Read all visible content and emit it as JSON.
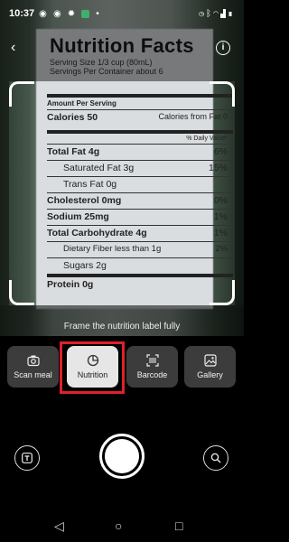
{
  "status_bar": {
    "time": "10:37",
    "left_icons": [
      "whatsapp-icon",
      "whatsapp-icon",
      "settings-icon",
      "app-icon",
      "dot-icon"
    ],
    "right_icons": [
      "alarm-icon",
      "bluetooth-icon",
      "wifi-icon",
      "signal-icon",
      "battery-icon"
    ]
  },
  "label_preview": {
    "title": "Nutrition Facts",
    "serving_size": "Serving Size 1/3 cup (80mL)",
    "servings_per": "Servings Per Container about 6",
    "amount_per": "Amount Per Serving",
    "calories": "Calories 50",
    "calories_fat": "Calories from Fat 0",
    "daily_value": "% Daily Value*",
    "rows": [
      {
        "label": "Total Fat 4g",
        "value": "6%"
      },
      {
        "label": "Saturated Fat 3g",
        "value": "15%"
      },
      {
        "label": "Trans Fat 0g",
        "value": ""
      },
      {
        "label": "Cholesterol 0mg",
        "value": "0%"
      },
      {
        "label": "Sodium 25mg",
        "value": "1%"
      },
      {
        "label": "Total Carbohydrate 4g",
        "value": "1%"
      },
      {
        "label": "Dietary Fiber less than 1g",
        "value": "2%"
      },
      {
        "label": "Sugars 2g",
        "value": ""
      },
      {
        "label": "Protein 0g",
        "value": ""
      }
    ]
  },
  "hint_text": "Frame the nutrition label fully",
  "modes": [
    {
      "label": "Scan meal",
      "icon": "camera-icon",
      "active": false
    },
    {
      "label": "Nutrition",
      "icon": "pie-chart-icon",
      "active": true
    },
    {
      "label": "Barcode",
      "icon": "barcode-scan-icon",
      "active": false
    },
    {
      "label": "Gallery",
      "icon": "image-icon",
      "active": false
    }
  ],
  "colors": {
    "highlight": "#e0202a",
    "active_chip": "#e6e6e6"
  }
}
